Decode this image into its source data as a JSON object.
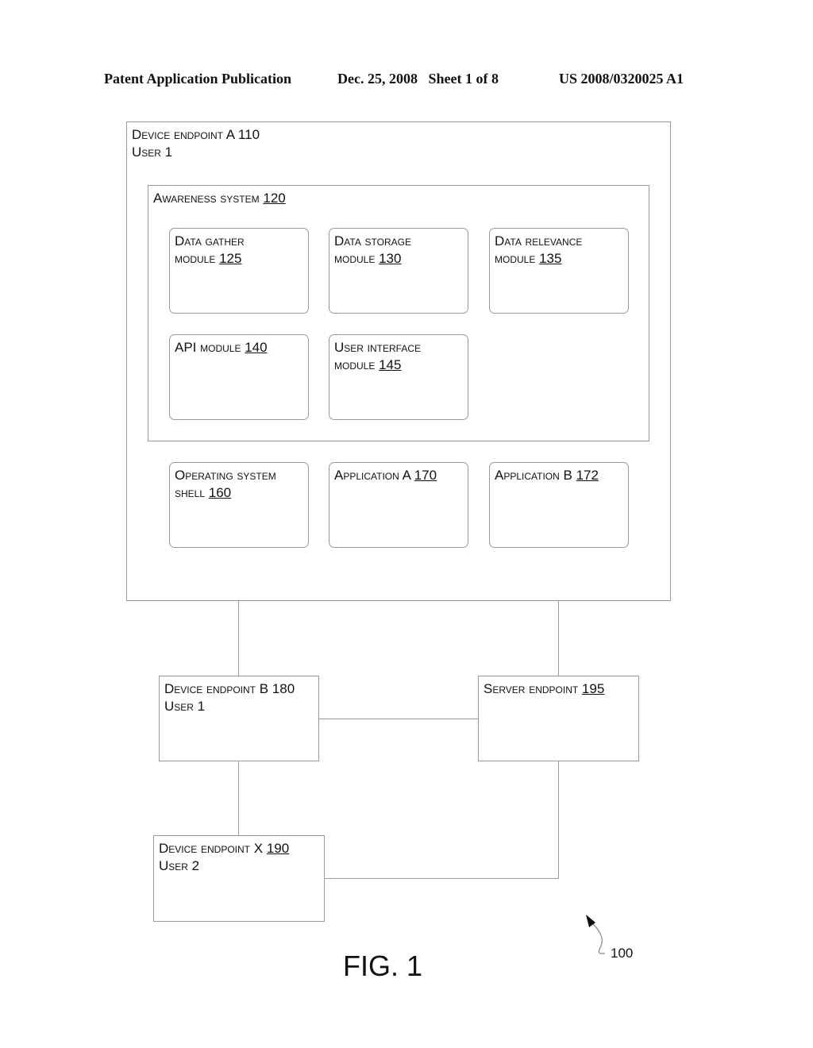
{
  "header": {
    "left": "Patent Application Publication",
    "middle": "Dec. 25, 2008   Sheet 1 of 8",
    "right": "US 2008/0320025 A1"
  },
  "device_a": {
    "line1": "Device endpoint A 110",
    "line2": "User 1"
  },
  "awareness": {
    "title": "Awareness system ",
    "num": "120"
  },
  "modules": {
    "data_gather": {
      "line1": "Data gather",
      "line2": "module ",
      "num": "125"
    },
    "data_storage": {
      "line1": "Data storage",
      "line2": "module ",
      "num": "130"
    },
    "data_relevance": {
      "line1": "Data relevance",
      "line2": "module ",
      "num": "135"
    },
    "api": {
      "line1": "API module ",
      "num": "140"
    },
    "user_interface": {
      "line1": "User interface",
      "line2": "module ",
      "num": "145"
    }
  },
  "apps": {
    "os_shell": {
      "line1": "Operating system",
      "line2": "shell ",
      "num": "160"
    },
    "app_a": {
      "line1": "Application A ",
      "num": "170"
    },
    "app_b": {
      "line1": "Application B ",
      "num": "172"
    }
  },
  "device_b": {
    "line1": "Device endpoint B 180",
    "line2": "User 1"
  },
  "server": {
    "line1": "Server endpoint ",
    "num": "195"
  },
  "device_x": {
    "line1": "Device endpoint X ",
    "num": "190",
    "line2": "User 2"
  },
  "figure": {
    "caption": "FIG. 1",
    "ref": "100"
  }
}
